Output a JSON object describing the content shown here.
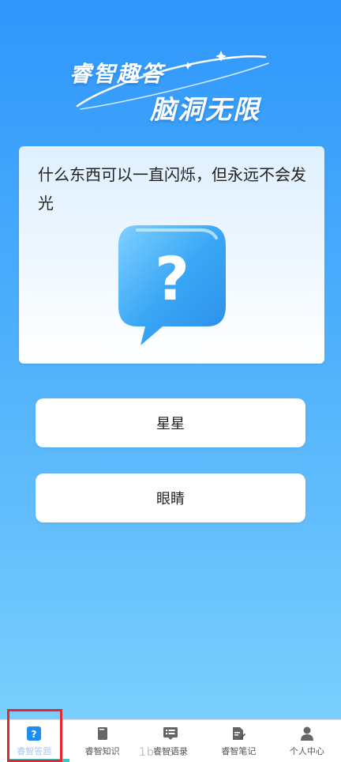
{
  "hero": {
    "title_line1": "睿智趣答",
    "title_line2": "脑洞无限"
  },
  "question": {
    "text": "什么东西可以一直闪烁，但永远不会发光",
    "bubble_icon": "question-bubble-icon"
  },
  "answers": [
    {
      "label": "星星"
    },
    {
      "label": "眼睛"
    }
  ],
  "tabbar": {
    "active_index": 0,
    "items": [
      {
        "label": "睿智答题",
        "icon": "question-mark-icon"
      },
      {
        "label": "睿智知识",
        "icon": "book-icon"
      },
      {
        "label": "睿智语录",
        "icon": "list-icon"
      },
      {
        "label": "睿智笔记",
        "icon": "note-edit-icon"
      },
      {
        "label": "个人中心",
        "icon": "person-icon"
      }
    ]
  },
  "watermark": "1b...S-L",
  "colors": {
    "accent": "#1e8ef5",
    "highlight": "#e8262e",
    "underline": "#3fc7c0"
  }
}
